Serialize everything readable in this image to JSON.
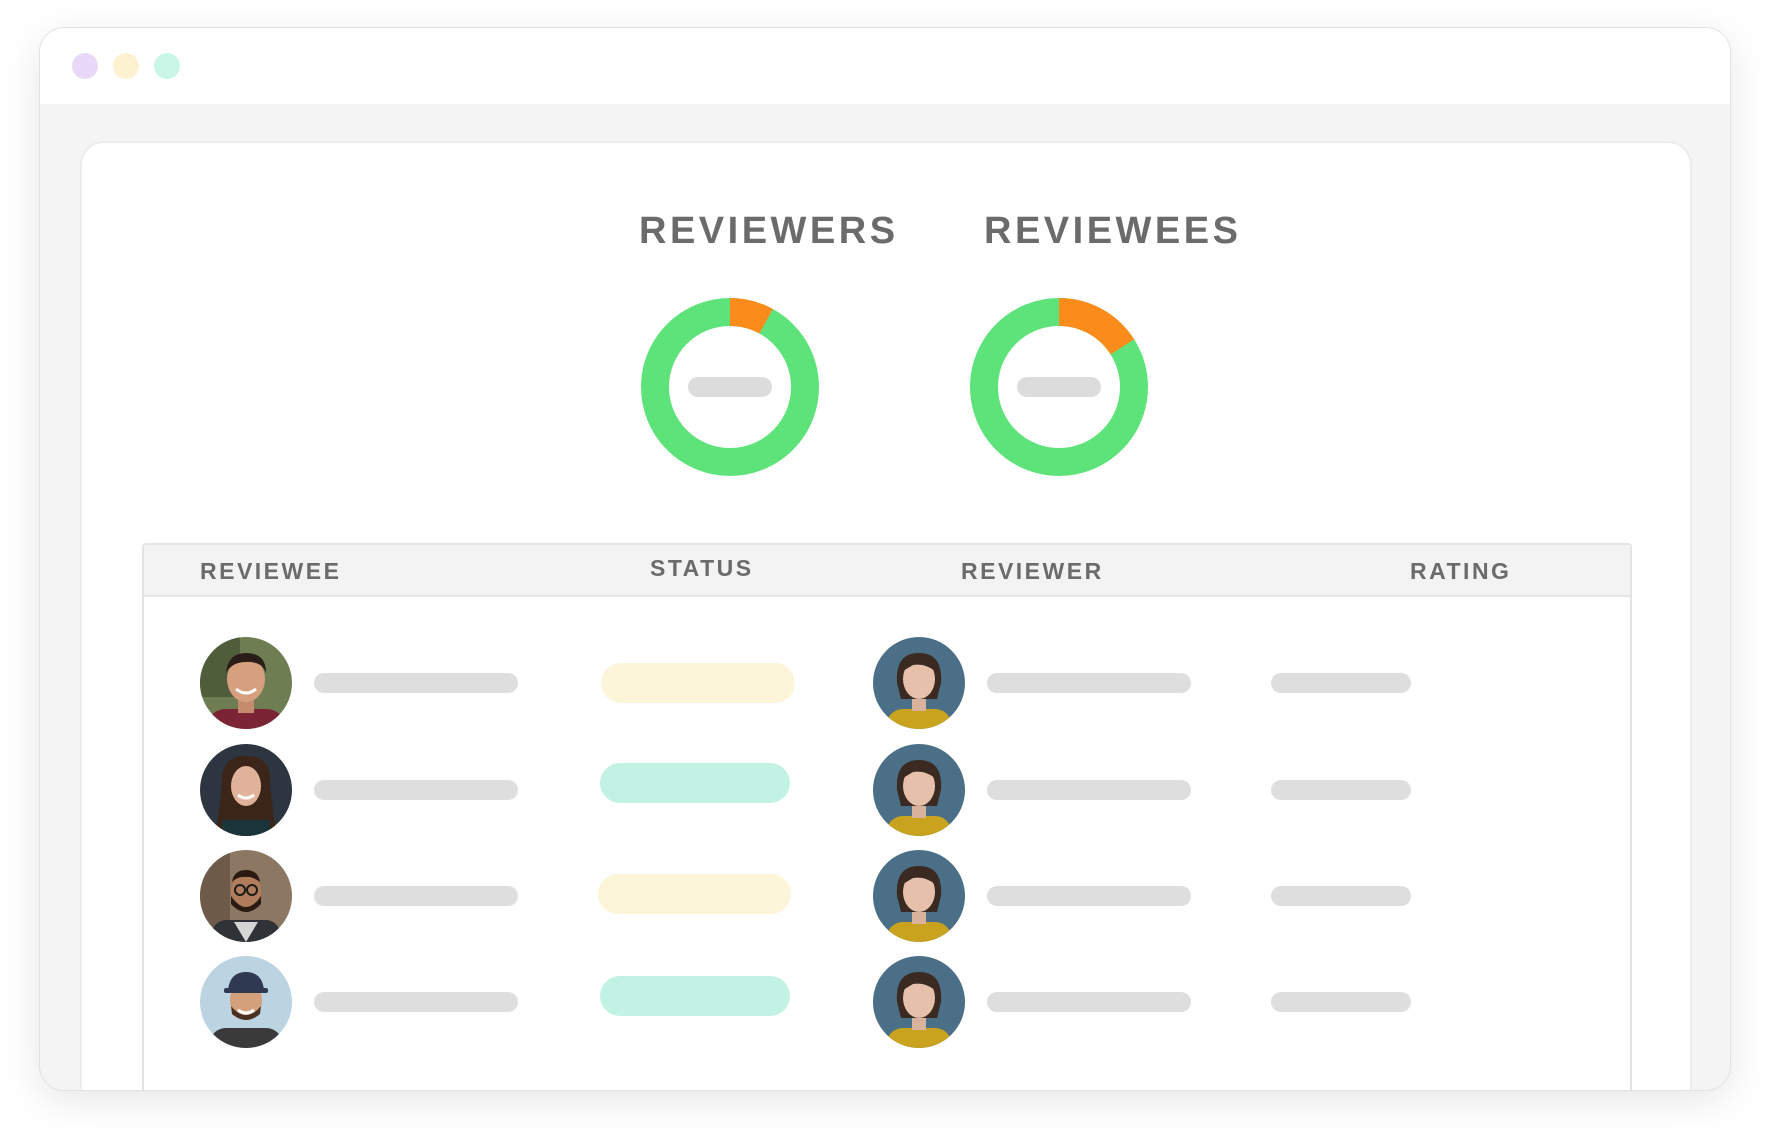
{
  "window": {
    "dots": [
      {
        "name": "window-dot-purple",
        "color": "#ead8f8"
      },
      {
        "name": "window-dot-yellow",
        "color": "#fdf2cf"
      },
      {
        "name": "window-dot-green",
        "color": "#c9f6e6"
      }
    ]
  },
  "charts": {
    "reviewers": {
      "title": "REVIEWERS",
      "complete_fraction": 0.92,
      "pending_fraction": 0.08
    },
    "reviewees": {
      "title": "REVIEWEES",
      "complete_fraction": 0.84,
      "pending_fraction": 0.16
    }
  },
  "colors": {
    "complete": "#5ee37a",
    "pending": "#fb8c1c",
    "status_pending": "#fdf5da",
    "status_complete": "#c2f2e3"
  },
  "table": {
    "headers": {
      "reviewee": "REVIEWEE",
      "status": "STATUS",
      "reviewer": "REVIEWER",
      "rating": "RATING"
    },
    "rows": [
      {
        "reviewee_avatar": "man-dark-hair-smiling-avatar",
        "status_color": "#fdf5da",
        "reviewer_avatar": "woman-yellow-shirt-avatar"
      },
      {
        "reviewee_avatar": "woman-long-hair-avatar",
        "status_color": "#c2f2e3",
        "reviewer_avatar": "woman-yellow-shirt-avatar"
      },
      {
        "reviewee_avatar": "man-glasses-beard-avatar",
        "status_color": "#fdf5da",
        "reviewer_avatar": "woman-yellow-shirt-avatar"
      },
      {
        "reviewee_avatar": "man-cap-beard-avatar",
        "status_color": "#c2f2e3",
        "reviewer_avatar": "woman-yellow-shirt-avatar"
      }
    ]
  }
}
